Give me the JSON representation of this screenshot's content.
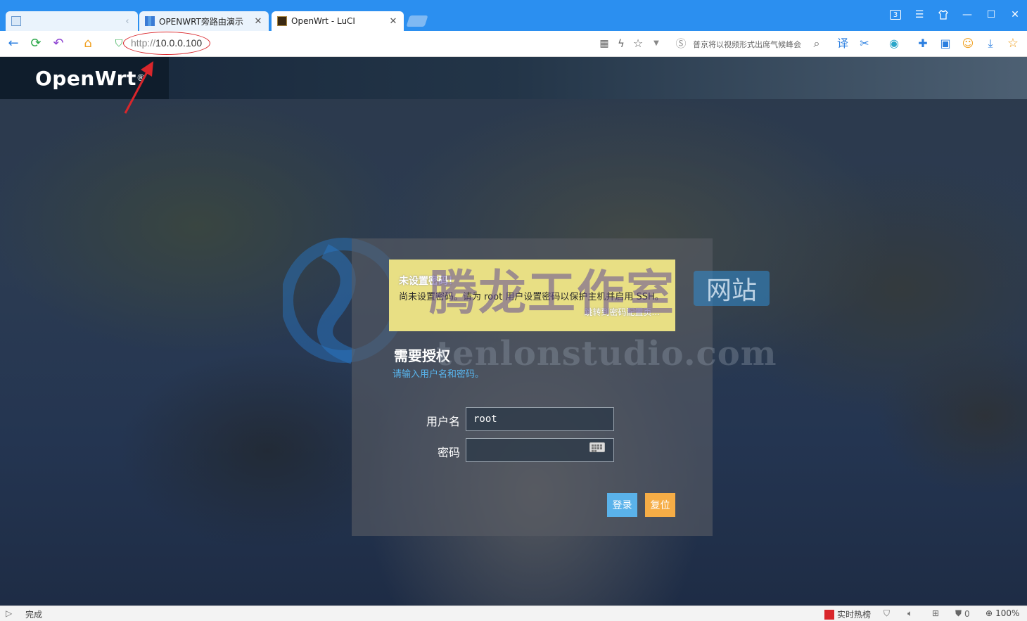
{
  "browser": {
    "tabs": [
      {
        "title": ""
      },
      {
        "title": "OPENWRT旁路由演示"
      },
      {
        "title": "OpenWrt - LuCI"
      }
    ],
    "window_badge": "3",
    "address": {
      "protocol": "http://",
      "host": "10.0.0.100"
    },
    "search_hint": "普京将以视频形式出席气候峰会"
  },
  "page": {
    "brand": "OpenWrt",
    "brand_mark": "®",
    "alert": {
      "title": "未设置密码！",
      "text": "尚未设置密码。请为 root 用户设置密码以保护主机并启用 SSH。",
      "link": "跳转到密码配置页..."
    },
    "auth": {
      "title": "需要授权",
      "description": "请输入用户名和密码。",
      "username_label": "用户名",
      "username_value": "root",
      "password_label": "密码",
      "password_value": "",
      "login_button": "登录",
      "reset_button": "复位"
    },
    "watermark": {
      "cn": "腾龙工作室",
      "net": "网站",
      "en": "tenlonstudio.com"
    }
  },
  "statusbar": {
    "status": "完成",
    "hot_label": "实时热榜",
    "counter": "0",
    "zoom": "100%"
  },
  "colors": {
    "tabbar": "#2b8ff0",
    "login_button": "#5ab2ea",
    "reset_button": "#f6ad46",
    "alert_bg": "#e8df84",
    "annotation": "#d9262b"
  }
}
